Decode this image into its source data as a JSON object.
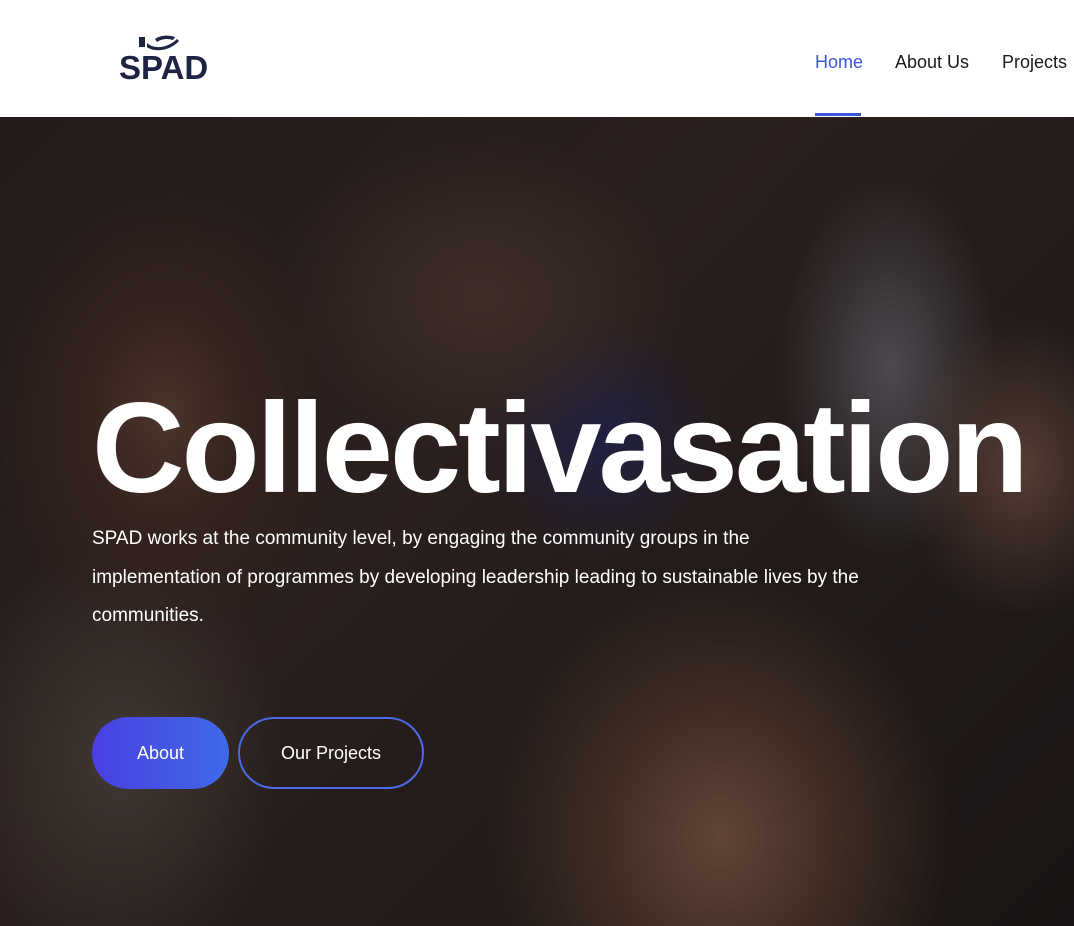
{
  "brand": {
    "name": "SPAD",
    "logo_icon": "hand-icon",
    "text_color": "#1d2444"
  },
  "nav": {
    "items": [
      {
        "label": "Home",
        "active": true
      },
      {
        "label": "About Us",
        "active": false
      },
      {
        "label": "Projects",
        "active": false
      }
    ],
    "active_color": "#3b56d9"
  },
  "hero": {
    "title": "Collectivasation",
    "description": "SPAD works at the community level, by engaging the community groups in the implementation of programmes by developing leadership leading to sustainable lives by the communities.",
    "buttons": {
      "about_label": "About",
      "projects_label": "Our Projects"
    },
    "accent_color": "#4a3fe0"
  }
}
